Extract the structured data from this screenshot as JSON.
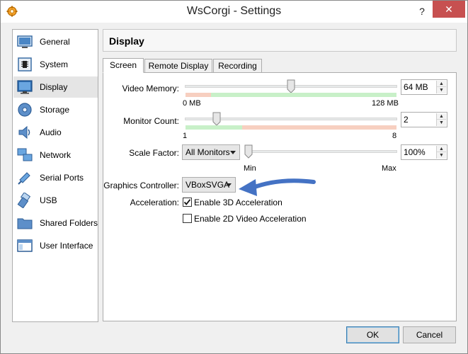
{
  "window": {
    "title": "WsCorgi - Settings",
    "help_label": "?",
    "close_label": "✕"
  },
  "sidebar": {
    "items": [
      {
        "label": "General",
        "icon": "general-icon"
      },
      {
        "label": "System",
        "icon": "chip-icon"
      },
      {
        "label": "Display",
        "icon": "monitor-icon",
        "selected": true
      },
      {
        "label": "Storage",
        "icon": "disk-icon"
      },
      {
        "label": "Audio",
        "icon": "speaker-icon"
      },
      {
        "label": "Network",
        "icon": "network-icon"
      },
      {
        "label": "Serial Ports",
        "icon": "serial-port-icon"
      },
      {
        "label": "USB",
        "icon": "usb-icon"
      },
      {
        "label": "Shared Folders",
        "icon": "folder-icon"
      },
      {
        "label": "User Interface",
        "icon": "window-icon"
      }
    ]
  },
  "main": {
    "title": "Display",
    "tabs": [
      {
        "label": "Screen",
        "active": true
      },
      {
        "label": "Remote Display"
      },
      {
        "label": "Recording"
      }
    ],
    "screen": {
      "video_memory": {
        "label": "Video Memory:",
        "min_label": "0 MB",
        "max_label": "128 MB",
        "value": "64 MB",
        "fraction": 0.5
      },
      "monitor_count": {
        "label": "Monitor Count:",
        "min_label": "1",
        "max_label": "8",
        "value": "2",
        "fraction": 0.143
      },
      "scale_factor": {
        "label": "Scale Factor:",
        "combo_value": "All Monitors",
        "min_label": "Min",
        "max_label": "Max",
        "value": "100%",
        "fraction": 0.0
      },
      "graphics_controller": {
        "label": "Graphics Controller:",
        "value": "VBoxSVGA"
      },
      "acceleration": {
        "label": "Acceleration:",
        "enable_3d": {
          "label": "Enable 3D Acceleration",
          "checked": true
        },
        "enable_2d": {
          "label": "Enable 2D Video Acceleration",
          "checked": false
        }
      }
    }
  },
  "buttons": {
    "ok": "OK",
    "cancel": "Cancel"
  },
  "colors": {
    "accent_arrow": "#4472c4",
    "scale_green": "#c8f0c8",
    "scale_red": "#f7cfc0",
    "close_red": "#c75050"
  }
}
